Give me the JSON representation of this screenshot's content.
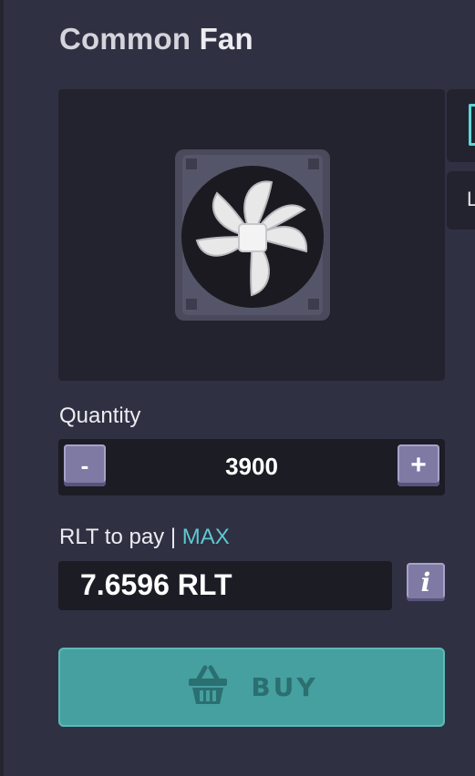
{
  "item": {
    "rarity": "Common",
    "name": "Fan",
    "icon": "fan-icon"
  },
  "quantity": {
    "label": "Quantity",
    "minus_label": "-",
    "plus_label": "+",
    "value": "3900"
  },
  "payment": {
    "label": "RLT to pay |",
    "max_label": "MAX",
    "amount": "7.6596 RLT",
    "info_label": "i"
  },
  "side_tabs": {
    "second_glyph": "L"
  },
  "buy": {
    "label": "BUY",
    "icon": "basket-icon"
  },
  "colors": {
    "background": "#2f3042",
    "panel": "#23232f",
    "accent": "#45a09f",
    "button": "#7f7aa4",
    "max_link": "#5fc8d0"
  }
}
